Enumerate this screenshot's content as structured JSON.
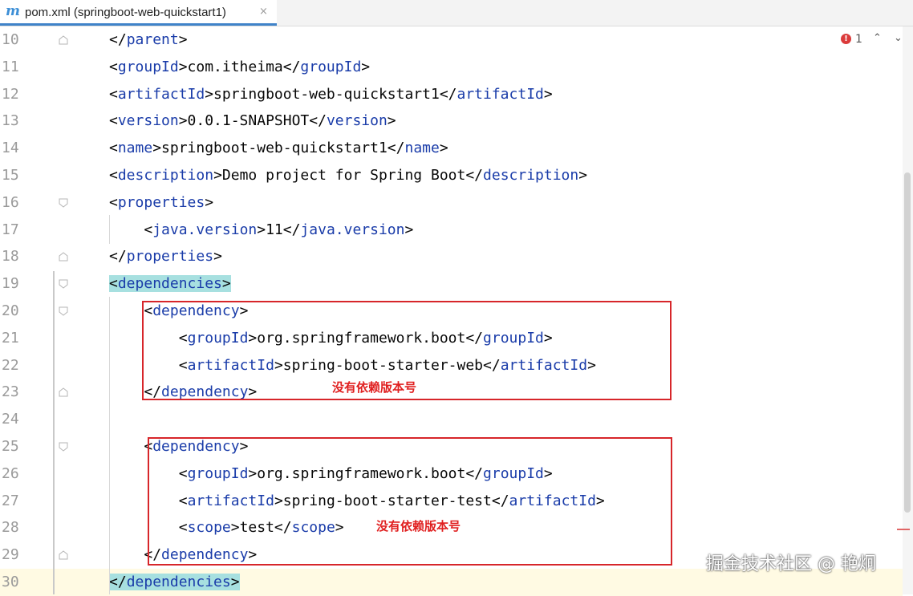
{
  "tab": {
    "icon": "m",
    "title": "pom.xml (springboot-web-quickstart1)",
    "close": "×"
  },
  "inspections": {
    "error_count": "1",
    "error_icon": "!",
    "prev": "⌃",
    "next": "⌄"
  },
  "lines": [
    {
      "num": "10",
      "indent": 0,
      "parts": [
        [
          "t",
          "</"
        ],
        [
          "g",
          "parent"
        ],
        [
          "t",
          ">"
        ]
      ]
    },
    {
      "num": "11",
      "indent": 0,
      "parts": [
        [
          "t",
          "<"
        ],
        [
          "g",
          "groupId"
        ],
        [
          "t",
          ">com.itheima</"
        ],
        [
          "g",
          "groupId"
        ],
        [
          "t",
          ">"
        ]
      ]
    },
    {
      "num": "12",
      "indent": 0,
      "parts": [
        [
          "t",
          "<"
        ],
        [
          "g",
          "artifactId"
        ],
        [
          "t",
          ">springboot-web-quickstart1</"
        ],
        [
          "g",
          "artifactId"
        ],
        [
          "t",
          ">"
        ]
      ]
    },
    {
      "num": "13",
      "indent": 0,
      "parts": [
        [
          "t",
          "<"
        ],
        [
          "g",
          "version"
        ],
        [
          "t",
          ">0.0.1-SNAPSHOT</"
        ],
        [
          "g",
          "version"
        ],
        [
          "t",
          ">"
        ]
      ]
    },
    {
      "num": "14",
      "indent": 0,
      "parts": [
        [
          "t",
          "<"
        ],
        [
          "g",
          "name"
        ],
        [
          "t",
          ">springboot-web-quickstart1</"
        ],
        [
          "g",
          "name"
        ],
        [
          "t",
          ">"
        ]
      ]
    },
    {
      "num": "15",
      "indent": 0,
      "parts": [
        [
          "t",
          "<"
        ],
        [
          "g",
          "description"
        ],
        [
          "t",
          ">Demo project for Spring Boot</"
        ],
        [
          "g",
          "description"
        ],
        [
          "t",
          ">"
        ]
      ]
    },
    {
      "num": "16",
      "indent": 0,
      "parts": [
        [
          "t",
          "<"
        ],
        [
          "g",
          "properties"
        ],
        [
          "t",
          ">"
        ]
      ]
    },
    {
      "num": "17",
      "indent": 1,
      "parts": [
        [
          "t",
          "<"
        ],
        [
          "g",
          "java.version"
        ],
        [
          "t",
          ">11</"
        ],
        [
          "g",
          "java.version"
        ],
        [
          "t",
          ">"
        ]
      ]
    },
    {
      "num": "18",
      "indent": 0,
      "parts": [
        [
          "t",
          "</"
        ],
        [
          "g",
          "properties"
        ],
        [
          "t",
          ">"
        ]
      ]
    },
    {
      "num": "19",
      "indent": 0,
      "highlight": true,
      "parts": [
        [
          "t",
          "<"
        ],
        [
          "g",
          "dependencies"
        ],
        [
          "t",
          ">"
        ]
      ]
    },
    {
      "num": "20",
      "indent": 1,
      "parts": [
        [
          "t",
          "<"
        ],
        [
          "g",
          "dependency"
        ],
        [
          "t",
          ">"
        ]
      ]
    },
    {
      "num": "21",
      "indent": 2,
      "parts": [
        [
          "t",
          "<"
        ],
        [
          "g",
          "groupId"
        ],
        [
          "t",
          ">org.springframework.boot</"
        ],
        [
          "g",
          "groupId"
        ],
        [
          "t",
          ">"
        ]
      ]
    },
    {
      "num": "22",
      "indent": 2,
      "parts": [
        [
          "t",
          "<"
        ],
        [
          "g",
          "artifactId"
        ],
        [
          "t",
          ">spring-boot-starter-web</"
        ],
        [
          "g",
          "artifactId"
        ],
        [
          "t",
          ">"
        ]
      ]
    },
    {
      "num": "23",
      "indent": 1,
      "parts": [
        [
          "t",
          "</"
        ],
        [
          "g",
          "dependency"
        ],
        [
          "t",
          ">"
        ]
      ]
    },
    {
      "num": "24",
      "indent": 0,
      "parts": []
    },
    {
      "num": "25",
      "indent": 1,
      "parts": [
        [
          "t",
          "<"
        ],
        [
          "g",
          "dependency"
        ],
        [
          "t",
          ">"
        ]
      ]
    },
    {
      "num": "26",
      "indent": 2,
      "parts": [
        [
          "t",
          "<"
        ],
        [
          "g",
          "groupId"
        ],
        [
          "t",
          ">org.springframework.boot</"
        ],
        [
          "g",
          "groupId"
        ],
        [
          "t",
          ">"
        ]
      ]
    },
    {
      "num": "27",
      "indent": 2,
      "parts": [
        [
          "t",
          "<"
        ],
        [
          "g",
          "artifactId"
        ],
        [
          "t",
          ">spring-boot-starter-test</"
        ],
        [
          "g",
          "artifactId"
        ],
        [
          "t",
          ">"
        ]
      ]
    },
    {
      "num": "28",
      "indent": 2,
      "parts": [
        [
          "t",
          "<"
        ],
        [
          "g",
          "scope"
        ],
        [
          "t",
          ">test</"
        ],
        [
          "g",
          "scope"
        ],
        [
          "t",
          ">"
        ]
      ]
    },
    {
      "num": "29",
      "indent": 1,
      "parts": [
        [
          "t",
          "</"
        ],
        [
          "g",
          "dependency"
        ],
        [
          "t",
          ">"
        ]
      ]
    },
    {
      "num": "30",
      "indent": 0,
      "highlight": true,
      "current": true,
      "parts": [
        [
          "t",
          "</"
        ],
        [
          "g",
          "dependencies"
        ],
        [
          "t",
          ">"
        ]
      ]
    }
  ],
  "annotations": {
    "note_web": "没有依赖版本号",
    "note_test": "没有依赖版本号"
  },
  "watermark": "掘金技术社区 @ 艳炯",
  "colors": {
    "tag": "#1a3ca9",
    "text": "#080808",
    "line_number": "#9a9a9a",
    "match_highlight": "#a7e0e0",
    "annotation_red": "#d7262a",
    "current_line": "#fffae3",
    "tab_underline": "#4083c9"
  }
}
